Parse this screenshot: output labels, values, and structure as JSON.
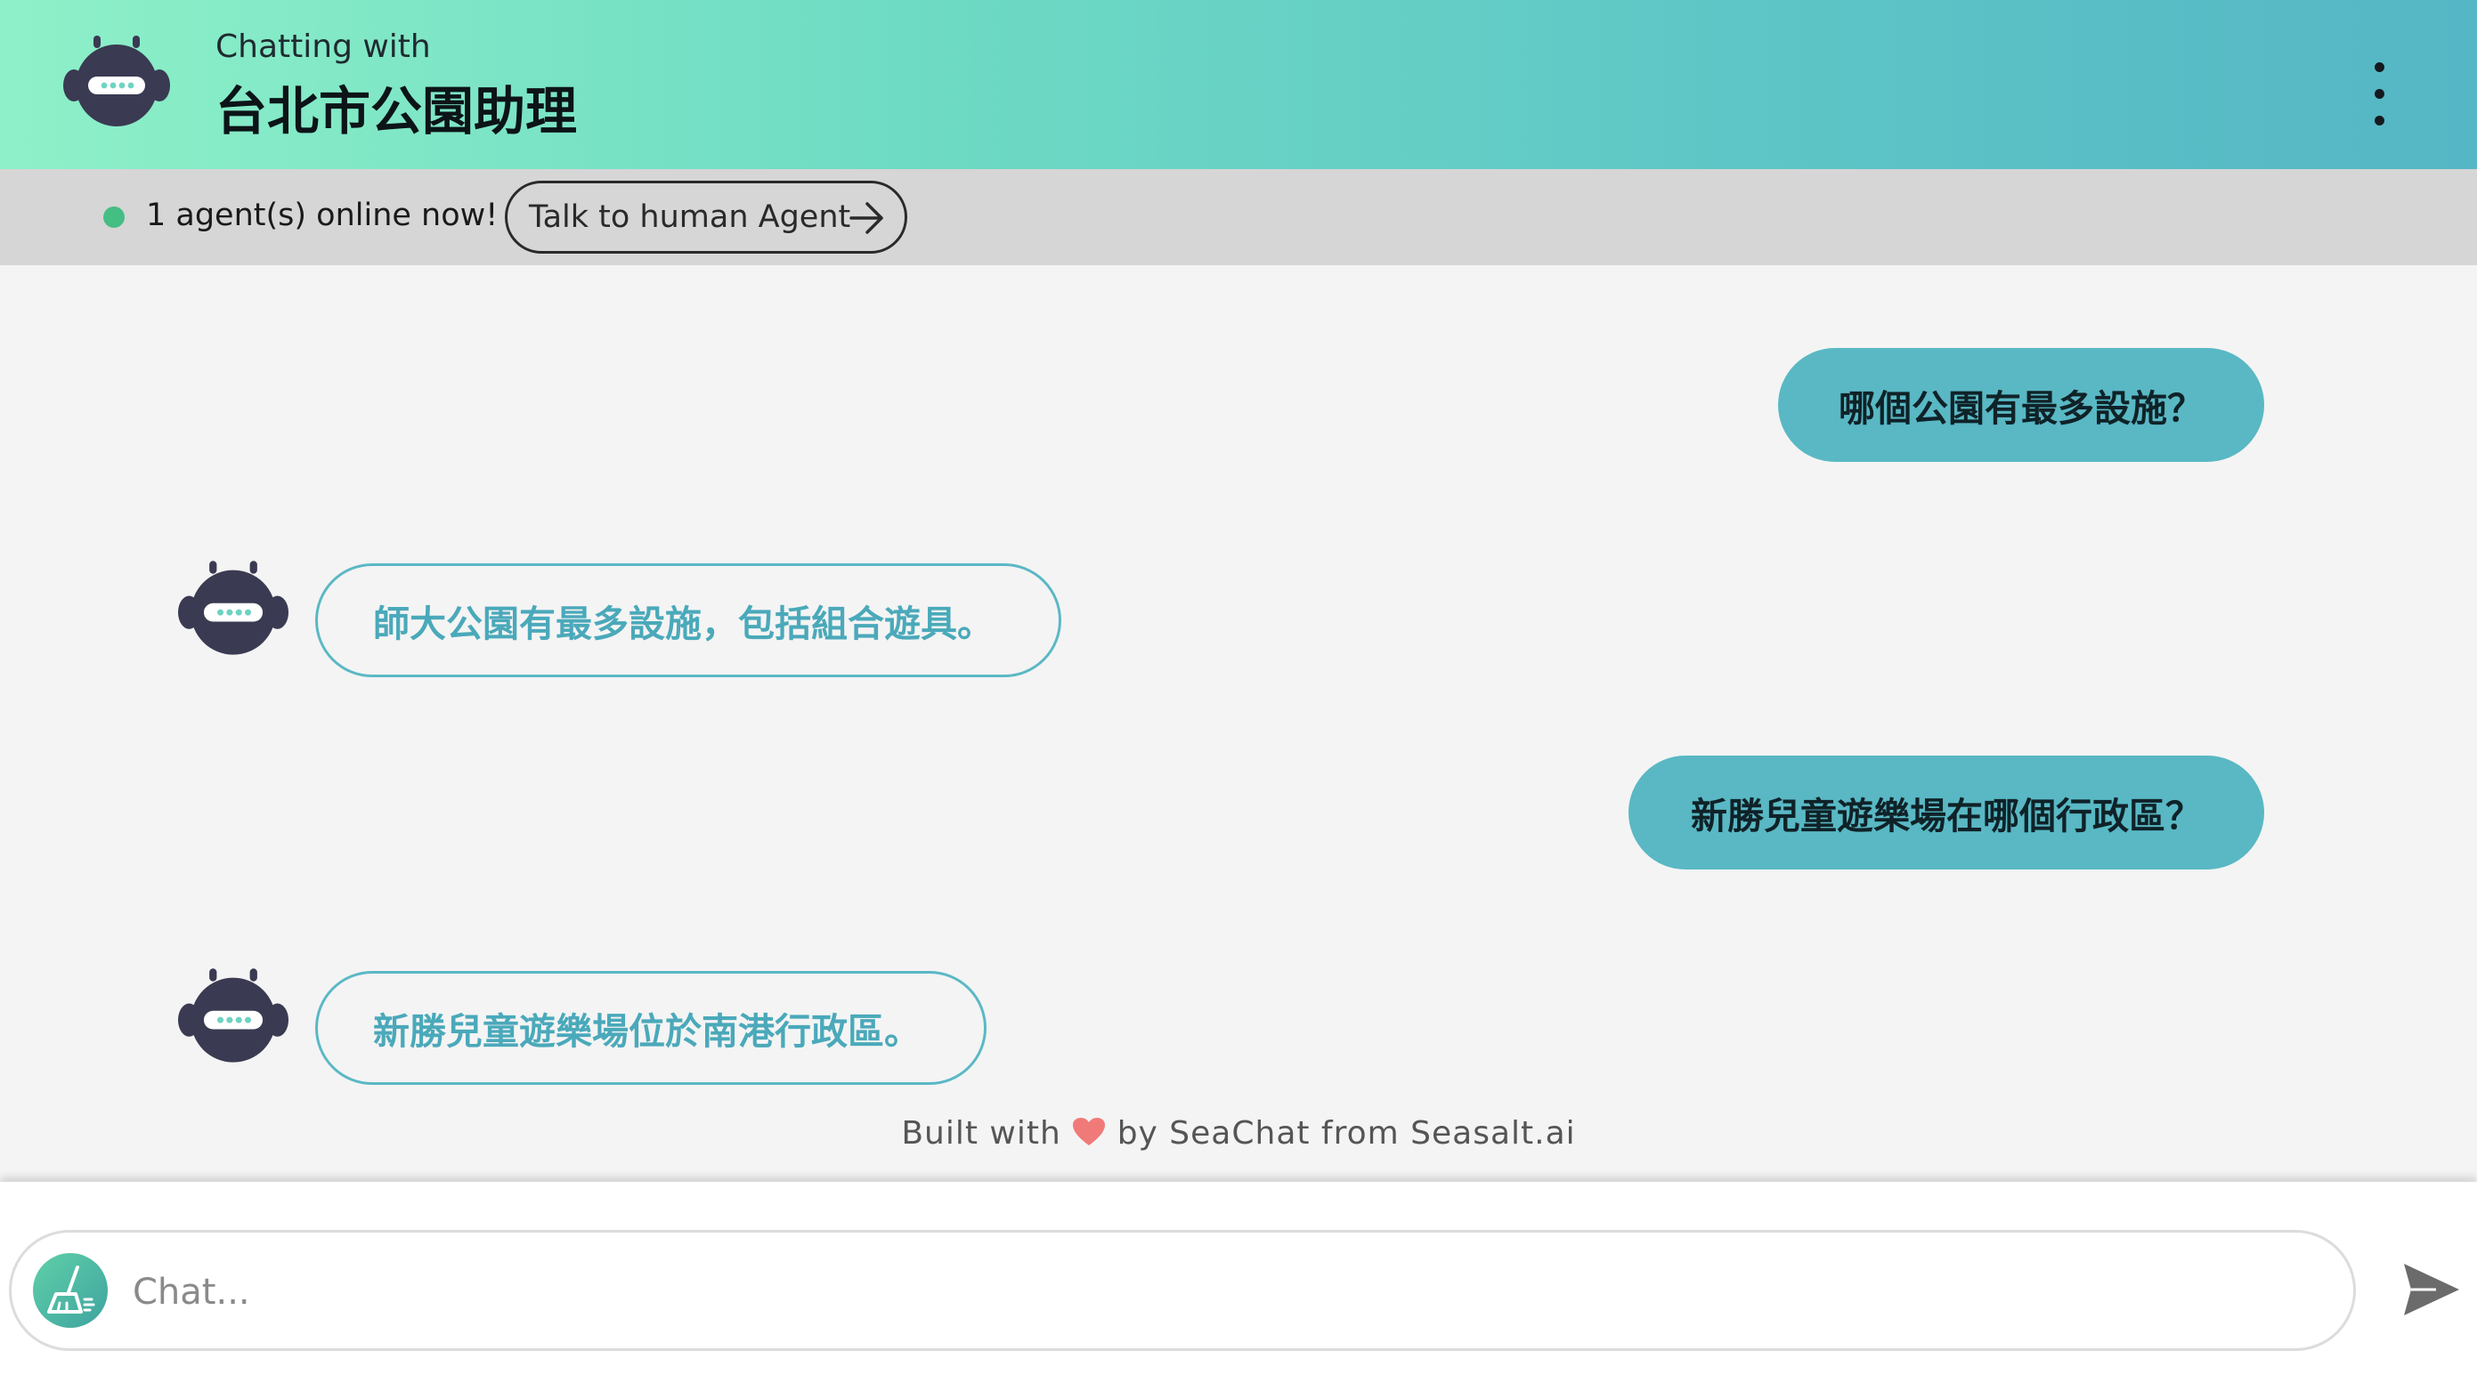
{
  "header": {
    "subtitle": "Chatting with",
    "title": "台北市公園助理"
  },
  "status": {
    "online_text": "1 agent(s) online now!",
    "human_button_label": "Talk to human Agent"
  },
  "messages": [
    {
      "role": "user",
      "text": "哪個公園有最多設施？"
    },
    {
      "role": "bot",
      "text": "師大公園有最多設施，包括組合遊具。"
    },
    {
      "role": "user",
      "text": "新勝兒童遊樂場在哪個行政區？"
    },
    {
      "role": "bot",
      "text": "新勝兒童遊樂場位於南港行政區。"
    }
  ],
  "footer": {
    "built_prefix": "Built with",
    "built_suffix": "by SeaChat from Seasalt.ai",
    "input_placeholder": "Chat..."
  },
  "colors": {
    "user_bubble": "#59b8c4",
    "bot_text": "#4aa9ba",
    "online": "#45be84",
    "header_start": "#8ef0c8",
    "header_end": "#55b6c5"
  }
}
